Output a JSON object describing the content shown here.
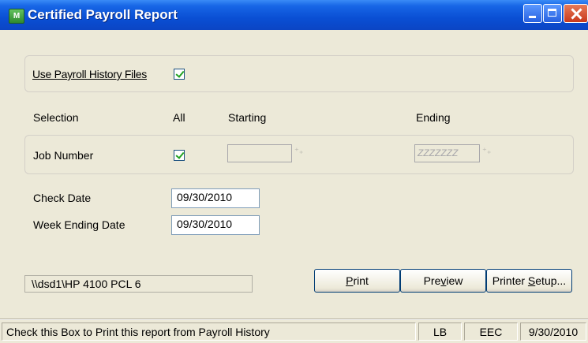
{
  "window": {
    "title": "Certified Payroll Report",
    "app_icon": "MAS",
    "controls": [
      "minimize-icon",
      "maximize-icon",
      "close-icon"
    ]
  },
  "options": {
    "use_history_label": "Use Payroll History Files",
    "use_history_checked": true
  },
  "selection": {
    "col_selection": "Selection",
    "col_all": "All",
    "col_starting": "Starting",
    "col_ending": "Ending",
    "job_number_label": "Job Number",
    "job_number_all_checked": true,
    "starting_value": "",
    "ending_value": "ZZZZZZZ"
  },
  "dates": {
    "check_date_label": "Check Date",
    "check_date_value": "09/30/2010",
    "week_ending_label": "Week Ending Date",
    "week_ending_value": "09/30/2010"
  },
  "printer": {
    "name": "\\\\dsd1\\HP 4100 PCL 6"
  },
  "buttons": {
    "print_pre": "",
    "print_u": "P",
    "print_post": "rint",
    "preview_pre": "Pre",
    "preview_u": "v",
    "preview_post": "iew",
    "setup_pre": "Printer ",
    "setup_u": "S",
    "setup_post": "etup..."
  },
  "status": {
    "message": "Check this Box to Print this report from Payroll History",
    "user": "LB",
    "company": "EEC",
    "date": "9/30/2010"
  }
}
